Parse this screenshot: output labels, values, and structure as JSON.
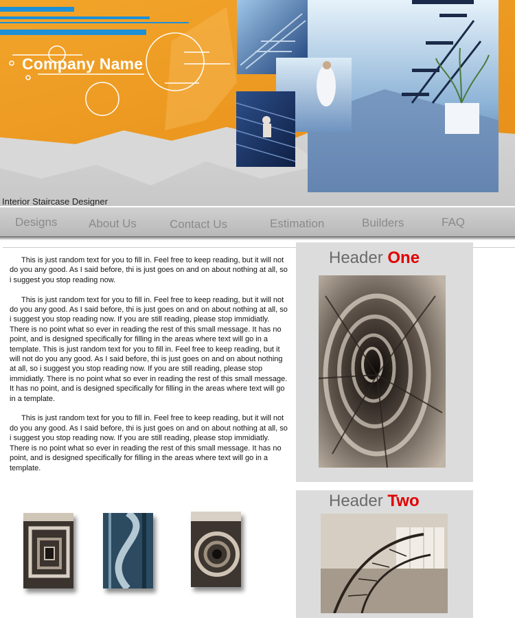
{
  "header": {
    "company_name": "Company Name",
    "tagline": "Interior Staircase Designer"
  },
  "nav": {
    "items": [
      {
        "label": "Designs"
      },
      {
        "label": "About Us"
      },
      {
        "label": "Contact Us"
      },
      {
        "label": "Estimation"
      },
      {
        "label": "Builders"
      },
      {
        "label": "FAQ"
      }
    ]
  },
  "content": {
    "paragraphs": [
      "This is just random text for you to fill in.  Feel free to keep reading, but it will not do you any good.  As I said before, thi is just goes on and on about nothing at all, so i suggest you stop reading now.",
      "This is just random text for you to fill in.  Feel free to keep reading, but it will not do you any good.  As I said before, thi is just goes on and on about nothing at all, so i suggest you stop reading now.  If you are still reading, please stop immidiatly.  There is no point what so ever in reading the rest of this small message.  It has no point, and is designed specifically for filling in the areas where text will go in a template.  This is just random text for you to fill in.  Feel free to keep reading, but it will not do you any good.  As I said before, thi is just goes on and on about nothing at all, so i suggest you stop reading now.  If you are still reading, please stop immidiatly.  There is no point what so ever in reading the rest of this small message.  It has no point, and is designed specifically for filling in the areas where text will go in a template.",
      "This is just random text for you to fill in.  Feel free to keep reading, but it will not do you any good.  As I said before, thi is just goes on and on about nothing at all, so i suggest you stop reading now.  If you are still reading, please stop immidiatly.  There is no point what so ever in reading the rest of this small message.  It has no point, and is designed specifically for filling in the areas where text will go in a template."
    ]
  },
  "sidebar": {
    "panel_one": {
      "header_prefix": "Header ",
      "header_accent": "One"
    },
    "panel_two": {
      "header_prefix": "Header ",
      "header_accent": "Two"
    }
  },
  "colors": {
    "banner_orange": "#f0a020",
    "banner_blue": "#1e90d8",
    "accent_red": "#e10000",
    "nav_text": "#8a8a8a",
    "panel_bg": "#dcdcdc"
  },
  "icons": {
    "logo": "circles-and-lines-logo"
  }
}
